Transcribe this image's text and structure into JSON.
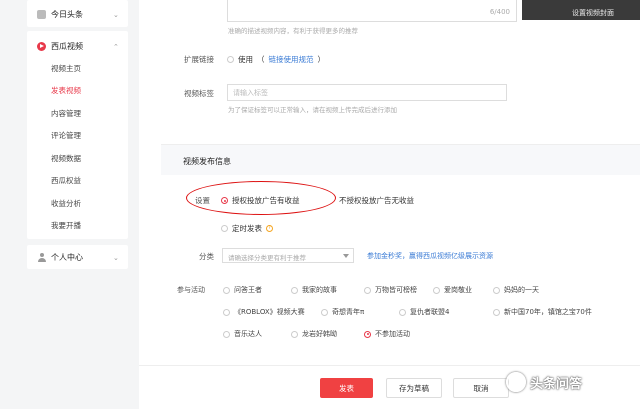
{
  "sidebar": {
    "top_label": "今日头条",
    "section_label": "西瓜视频",
    "items": [
      {
        "label": "视频主页",
        "active": false
      },
      {
        "label": "发表视频",
        "active": true
      },
      {
        "label": "内容管理",
        "active": false
      },
      {
        "label": "评论管理",
        "active": false
      },
      {
        "label": "视频数据",
        "active": false
      },
      {
        "label": "西瓜权益",
        "active": false
      },
      {
        "label": "收益分析",
        "active": false
      },
      {
        "label": "我要开播",
        "active": false
      }
    ],
    "personal_label": "个人中心"
  },
  "description": {
    "counter": "6/400",
    "hint": "准确的描述视频内容，有利于获得更多的推荐"
  },
  "cover": {
    "label": "设置视频封面"
  },
  "extension": {
    "label": "扩展链接",
    "option": "使用",
    "link_text": "链接使用规范"
  },
  "tags": {
    "label": "视频标签",
    "placeholder": "请输入标签",
    "hint": "为了保证标签可以正常输入，请在视频上传完成后进行添加"
  },
  "publish_section": {
    "title": "视频发布信息",
    "settings_label": "设置",
    "ad_on": "授权投放广告有收益",
    "ad_off": "不授权投放广告无收益",
    "scheduled": "定时发表",
    "category_label": "分类",
    "category_placeholder": "请确选择分类更有利于推荐",
    "category_link": "参加金秒奖，赢得西瓜视频亿级展示资源",
    "activity_label": "参与活动",
    "activities": [
      {
        "label": "问答王者",
        "selected": false
      },
      {
        "label": "我家的故事",
        "selected": false
      },
      {
        "label": "万物皆可榜榜",
        "selected": false
      },
      {
        "label": "爱岗敬业",
        "selected": false
      },
      {
        "label": "妈妈的一天",
        "selected": false
      },
      {
        "label": "《ROBLOX》视频大赛",
        "selected": false
      },
      {
        "label": "奇想青年π",
        "selected": false
      },
      {
        "label": "复仇者联盟4",
        "selected": false
      },
      {
        "label": "新中国70年，镇馆之宝70件",
        "selected": false
      },
      {
        "label": "音乐达人",
        "selected": false
      },
      {
        "label": "龙岩好韩呦",
        "selected": false
      },
      {
        "label": "不参加活动",
        "selected": true
      }
    ]
  },
  "actions": {
    "publish": "发表",
    "save_draft": "存为草稿",
    "cancel": "取消"
  },
  "watermark": "头条问答",
  "colors": {
    "accent": "#f04142",
    "link": "#3a7bd5",
    "annotation": "#dd1111"
  }
}
